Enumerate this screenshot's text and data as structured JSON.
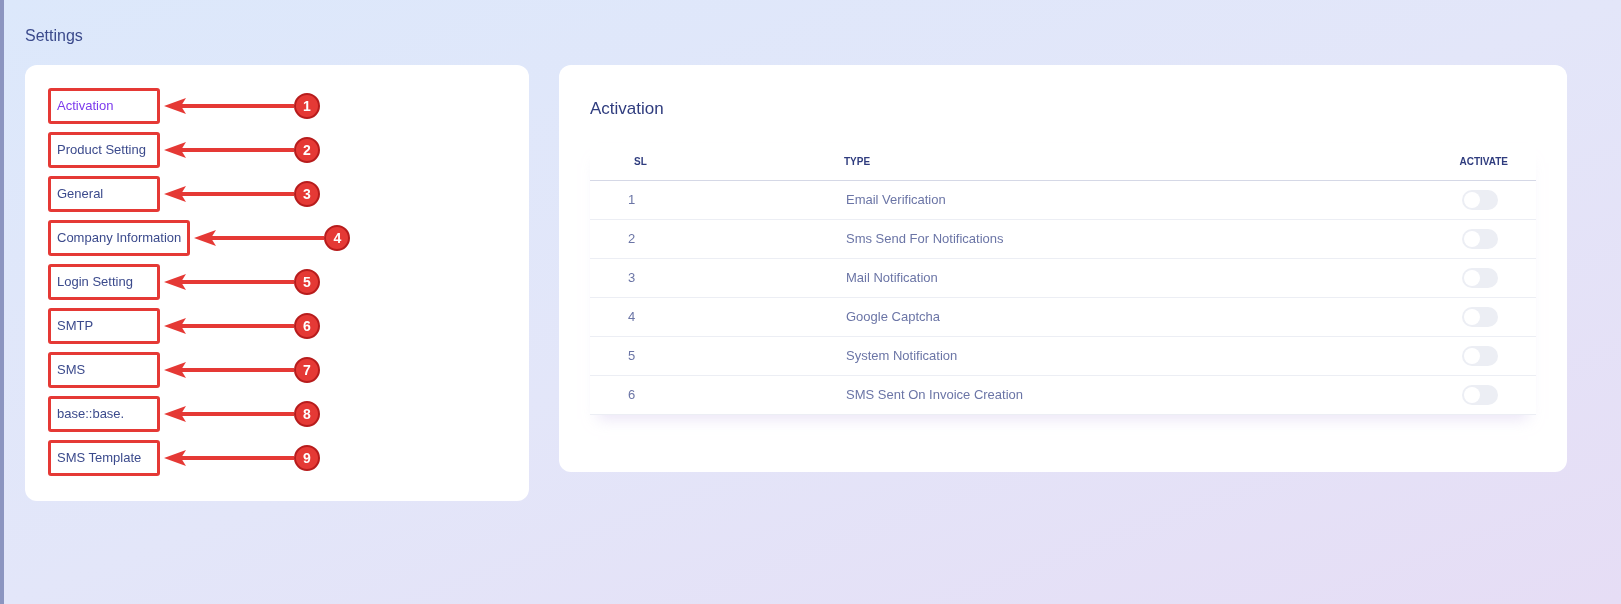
{
  "page_title": "Settings",
  "sidebar": {
    "items": [
      {
        "label": "Activation",
        "selected": true,
        "callout": "1"
      },
      {
        "label": "Product Setting",
        "selected": false,
        "callout": "2"
      },
      {
        "label": "General",
        "selected": false,
        "callout": "3"
      },
      {
        "label": "Company Information",
        "selected": false,
        "callout": "4"
      },
      {
        "label": "Login Setting",
        "selected": false,
        "callout": "5"
      },
      {
        "label": "SMTP",
        "selected": false,
        "callout": "6"
      },
      {
        "label": "SMS",
        "selected": false,
        "callout": "7"
      },
      {
        "label": "base::base.",
        "selected": false,
        "callout": "8"
      },
      {
        "label": "SMS Template",
        "selected": false,
        "callout": "9"
      }
    ]
  },
  "panel": {
    "title": "Activation",
    "table": {
      "columns": [
        "SL",
        "TYPE",
        "ACTIVATE"
      ],
      "rows": [
        {
          "sl": "1",
          "type": "Email Verification",
          "on": false
        },
        {
          "sl": "2",
          "type": "Sms Send For Notifications",
          "on": false
        },
        {
          "sl": "3",
          "type": "Mail Notification",
          "on": false
        },
        {
          "sl": "4",
          "type": "Google Captcha",
          "on": false
        },
        {
          "sl": "5",
          "type": "System Notification",
          "on": false
        },
        {
          "sl": "6",
          "type": "SMS Sent On Invoice Creation",
          "on": false
        }
      ]
    }
  }
}
